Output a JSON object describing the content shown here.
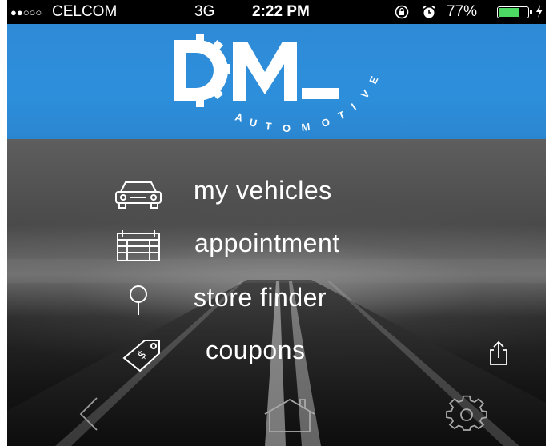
{
  "status_bar": {
    "signal_dots": "●●○○○",
    "carrier": "CELCOM",
    "network": "3G",
    "time": "2:22 PM",
    "battery_percent": "77%",
    "battery_level": 0.77,
    "icons": [
      "rotation-lock-icon",
      "alarm-icon",
      "battery-icon",
      "charging-icon"
    ]
  },
  "header": {
    "logo_text": "DM_",
    "logo_subtext": "AUTOMOTIVE",
    "background_color": "#2d8fdc"
  },
  "menu": {
    "items": [
      {
        "label": "my vehicles",
        "icon": "car-icon"
      },
      {
        "label": "appointment",
        "icon": "calendar-icon"
      },
      {
        "label": "store finder",
        "icon": "map-pin-icon"
      },
      {
        "label": "coupons",
        "icon": "price-tag-icon"
      }
    ]
  },
  "actions": {
    "share_icon": "share-icon"
  },
  "bottom_nav": {
    "back_icon": "back-chevron-icon",
    "home_icon": "home-icon",
    "settings_icon": "gear-icon"
  }
}
